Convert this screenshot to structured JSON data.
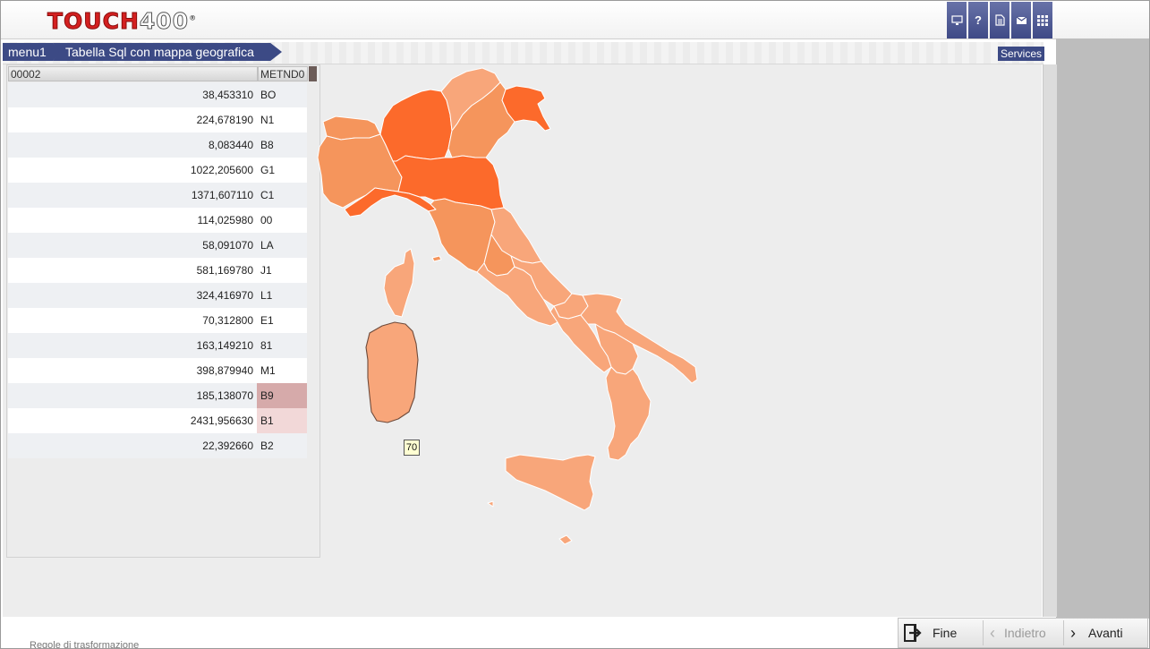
{
  "header": {
    "logo_text": "TOUCH400",
    "icons": [
      "monitor-icon",
      "help-icon",
      "document-icon",
      "mail-icon",
      "grid-icon"
    ],
    "help_glyph": "?"
  },
  "breadcrumb": {
    "items": [
      "menu1",
      "Tabella Sql  con mappa geografica"
    ],
    "services_label": "Services"
  },
  "table": {
    "columns": [
      "00002",
      "METND0"
    ],
    "rows": [
      {
        "value": "38,453310",
        "code": "BO"
      },
      {
        "value": "224,678190",
        "code": "N1"
      },
      {
        "value": "8,083440",
        "code": "B8"
      },
      {
        "value": "1022,205600",
        "code": "G1"
      },
      {
        "value": "1371,607110",
        "code": "C1"
      },
      {
        "value": "114,025980",
        "code": "00"
      },
      {
        "value": "58,091070",
        "code": "LA"
      },
      {
        "value": "581,169780",
        "code": "J1"
      },
      {
        "value": "324,416970",
        "code": "L1"
      },
      {
        "value": "70,312800",
        "code": "E1"
      },
      {
        "value": "163,149210",
        "code": "81"
      },
      {
        "value": "398,879940",
        "code": "M1"
      },
      {
        "value": "185,138070",
        "code": "B9"
      },
      {
        "value": "2431,956630",
        "code": "B1"
      },
      {
        "value": "22,392660",
        "code": "B2"
      }
    ],
    "highlight_colors": {
      "B9": "#d6aaaa",
      "B1": "#f2d8d8"
    }
  },
  "map": {
    "tooltip": "70",
    "colors": {
      "dark": "#fc6a2b",
      "mid": "#f5955c",
      "light": "#f8a67a",
      "border": "#ffffff"
    }
  },
  "footer": {
    "fine_label": "Fine",
    "back_label": "Indietro",
    "next_label": "Avanti"
  },
  "background_text": "Regole di trasformazione"
}
